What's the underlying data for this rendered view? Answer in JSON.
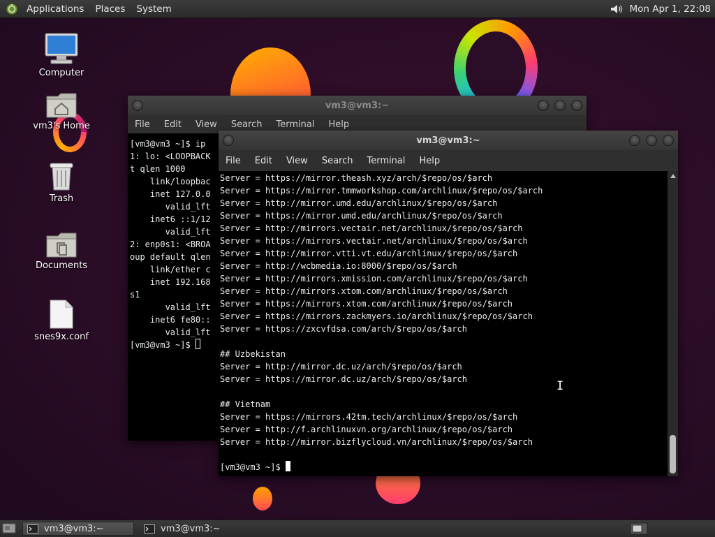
{
  "top_panel": {
    "menus": [
      "Applications",
      "Places",
      "System"
    ],
    "clock": "Mon Apr 1, 22:08",
    "icons": {
      "logo": "distro-logo-icon",
      "volume": "volume-icon"
    }
  },
  "desktop": {
    "icons": [
      {
        "label": "Computer",
        "icon": "computer-icon"
      },
      {
        "label": "vm3's Home",
        "icon": "home-folder-icon"
      },
      {
        "label": "Trash",
        "icon": "trash-icon"
      },
      {
        "label": "Documents",
        "icon": "documents-folder-icon"
      },
      {
        "label": "snes9x.conf",
        "icon": "text-file-icon"
      }
    ]
  },
  "back_window": {
    "title": "vm3@vm3:~",
    "menu": [
      "File",
      "Edit",
      "View",
      "Search",
      "Terminal",
      "Help"
    ],
    "lines": [
      "[vm3@vm3 ~]$ ip",
      "1: lo: <LOOPBACK",
      "t qlen 1000",
      "    link/loopbac",
      "    inet 127.0.0",
      "       valid_lft",
      "    inet6 ::1/12",
      "       valid_lft",
      "2: enp0s1: <BROA",
      "oup default qlen",
      "    link/ether c",
      "    inet 192.168",
      "s1",
      "       valid_lft",
      "    inet6 fe80::",
      "       valid_lft"
    ],
    "prompt": "[vm3@vm3 ~]$ "
  },
  "front_window": {
    "title": "vm3@vm3:~",
    "menu": [
      "File",
      "Edit",
      "View",
      "Search",
      "Terminal",
      "Help"
    ],
    "lines": [
      "Server = https://mirror.theash.xyz/arch/$repo/os/$arch",
      "Server = https://mirror.tmmworkshop.com/archlinux/$repo/os/$arch",
      "Server = http://mirror.umd.edu/archlinux/$repo/os/$arch",
      "Server = https://mirror.umd.edu/archlinux/$repo/os/$arch",
      "Server = http://mirrors.vectair.net/archlinux/$repo/os/$arch",
      "Server = https://mirrors.vectair.net/archlinux/$repo/os/$arch",
      "Server = http://mirror.vtti.vt.edu/archlinux/$repo/os/$arch",
      "Server = http://wcbmedia.io:8000/$repo/os/$arch",
      "Server = http://mirrors.xmission.com/archlinux/$repo/os/$arch",
      "Server = http://mirrors.xtom.com/archlinux/$repo/os/$arch",
      "Server = https://mirrors.xtom.com/archlinux/$repo/os/$arch",
      "Server = https://mirrors.zackmyers.io/archlinux/$repo/os/$arch",
      "Server = https://zxcvfdsa.com/arch/$repo/os/$arch",
      "",
      "## Uzbekistan",
      "Server = http://mirror.dc.uz/arch/$repo/os/$arch",
      "Server = https://mirror.dc.uz/arch/$repo/os/$arch",
      "",
      "## Vietnam",
      "Server = https://mirrors.42tm.tech/archlinux/$repo/os/$arch",
      "Server = http://f.archlinuxvn.org/archlinux/$repo/os/$arch",
      "Server = http://mirror.bizflycloud.vn/archlinux/$repo/os/$arch",
      ""
    ],
    "prompt": "[vm3@vm3 ~]$ "
  },
  "taskbar": {
    "tasks": [
      {
        "label": "vm3@vm3:~",
        "active": true
      },
      {
        "label": "vm3@vm3:~",
        "active": false
      }
    ]
  },
  "colors": {
    "accent_orange": "#ff8c2a",
    "accent_pink": "#ff3d6e",
    "terminal_bg": "#000000"
  }
}
